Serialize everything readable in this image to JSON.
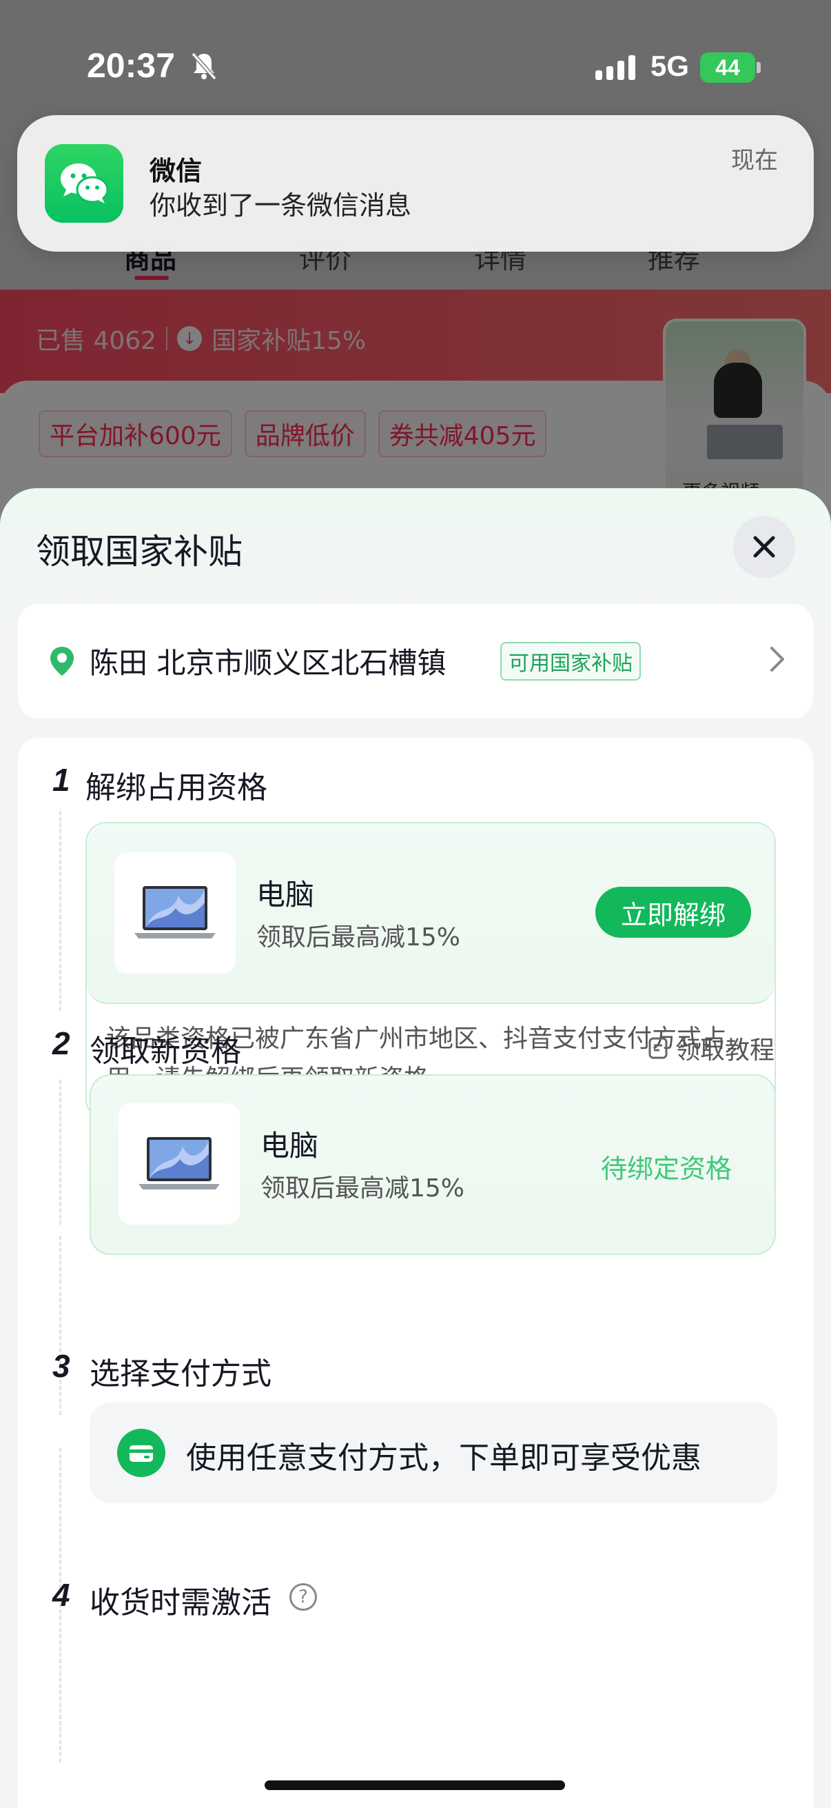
{
  "status_bar": {
    "time": "20:37",
    "network": "5G",
    "battery": "44"
  },
  "notification": {
    "app": "微信",
    "message": "你收到了一条微信消息",
    "time": "现在"
  },
  "background_page": {
    "tabs": [
      "商品",
      "评价",
      "详情",
      "推荐"
    ],
    "sold": "已售 4062",
    "subsidy": "国家补贴15%",
    "tags": [
      "平台加补600元",
      "品牌低价",
      "券共减405元"
    ],
    "video_label": "更多视频"
  },
  "sheet": {
    "title": "领取国家补贴",
    "address": {
      "text": "陈田 北京市顺义区北石槽镇",
      "badge": "可用国家补贴"
    },
    "step1": {
      "num": "1",
      "title": "解绑占用资格",
      "item_name": "电脑",
      "item_sub": "领取后最高减15%",
      "button": "立即解绑",
      "note": "该品类资格已被广东省广州市地区、抖音支付支付方式占用，请先解绑后再领取新资格"
    },
    "step2": {
      "num": "2",
      "title": "领取新资格",
      "tutorial": "领取教程",
      "item_name": "电脑",
      "item_sub": "领取后最高减15%",
      "status": "待绑定资格"
    },
    "step3": {
      "num": "3",
      "title": "选择支付方式",
      "pay_text": "使用任意支付方式，下单即可享受优惠"
    },
    "step4": {
      "num": "4",
      "title": "收货时需激活"
    }
  },
  "colors": {
    "accent_green": "#13b85b",
    "brand_red": "#fe2c55",
    "wechat_green": "#08c160"
  }
}
